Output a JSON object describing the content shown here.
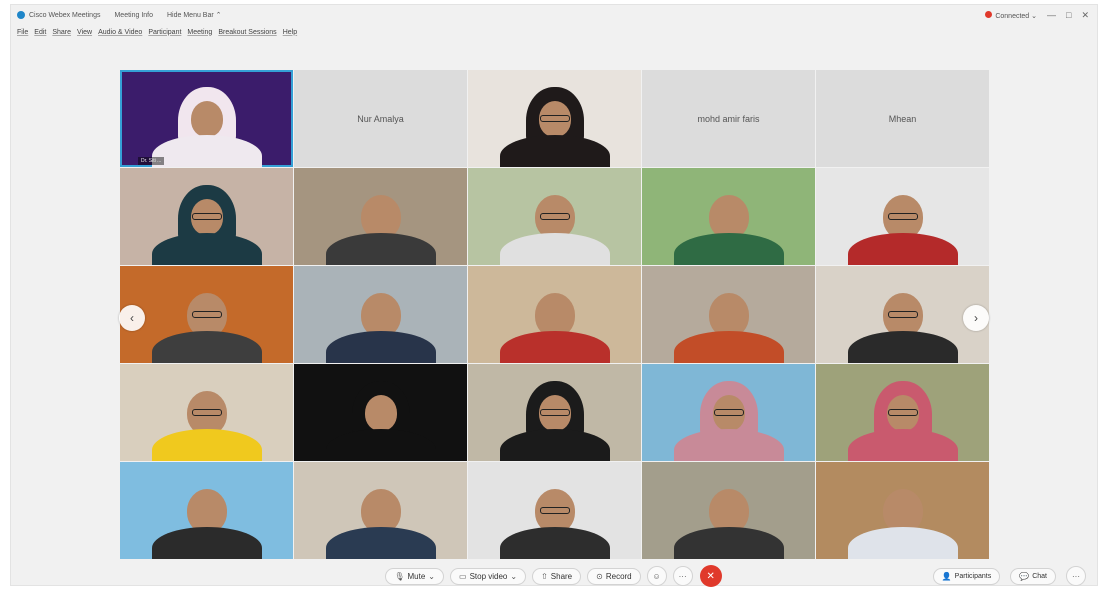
{
  "titlebar": {
    "app_name": "Cisco Webex Meetings",
    "meeting_info": "Meeting Info",
    "hide_menu": "Hide Menu Bar ⌃",
    "connected": "Connected ⌄",
    "min": "—",
    "max": "□",
    "close": "✕"
  },
  "menu": [
    "File",
    "Edit",
    "Share",
    "View",
    "Audio & Video",
    "Participant",
    "Meeting",
    "Breakout Sessions",
    "Help"
  ],
  "tiles": [
    {
      "label": "",
      "bg": "#3b1c6b",
      "person": "hijab",
      "hijab": "#f1e6ee",
      "shirt": "#efe9ef",
      "active": true,
      "name": "Dr. Siti ..."
    },
    {
      "label": "Nur Amalya",
      "noimg": true
    },
    {
      "label": "",
      "bg": "#e8e3dd",
      "person": "hijab",
      "hijab": "#1f1a1a",
      "shirt": "#1f1a1a",
      "glasses": true
    },
    {
      "label": "mohd amir faris",
      "noimg": true
    },
    {
      "label": "Mhean",
      "noimg": true
    },
    {
      "label": "",
      "bg": "#c6b3a6",
      "person": "hijab",
      "hijab": "#1c3a44",
      "shirt": "#1c3a44",
      "glasses": true
    },
    {
      "label": "",
      "bg": "#a59580",
      "person": "plain",
      "shirt": "#3a3a3a"
    },
    {
      "label": "",
      "bg": "#b7c4a2",
      "person": "plain",
      "shirt": "#e0e0e0",
      "glasses": true
    },
    {
      "label": "",
      "bg": "#8fb578",
      "person": "plain",
      "shirt": "#2f6b44"
    },
    {
      "label": "",
      "bg": "#e6e6e6",
      "person": "plain",
      "shirt": "#b42a2a",
      "glasses": true
    },
    {
      "label": "",
      "bg": "#c46a2a",
      "person": "plain",
      "shirt": "#3e3e3e",
      "glasses": true
    },
    {
      "label": "",
      "bg": "#aab3b8",
      "person": "plain",
      "shirt": "#28344a"
    },
    {
      "label": "",
      "bg": "#cdb89a",
      "person": "plain",
      "shirt": "#b9302b"
    },
    {
      "label": "",
      "bg": "#b5aa9c",
      "person": "plain",
      "shirt": "#c24d28"
    },
    {
      "label": "",
      "bg": "#d9d2c8",
      "person": "plain",
      "shirt": "#2a2a2a",
      "glasses": true
    },
    {
      "label": "",
      "bg": "#d9cfbe",
      "person": "plain",
      "shirt": "#f0c91e",
      "glasses": true
    },
    {
      "label": "",
      "bg": "#111111",
      "person": "hijab",
      "hijab": "#111",
      "shirt": "#111"
    },
    {
      "label": "",
      "bg": "#c0b8a6",
      "person": "hijab",
      "hijab": "#1b1b1b",
      "shirt": "#1b1b1b",
      "glasses": true
    },
    {
      "label": "",
      "bg": "#7fb7d6",
      "person": "hijab",
      "hijab": "#c88a98",
      "shirt": "#c88a98",
      "glasses": true
    },
    {
      "label": "",
      "bg": "#9ea27a",
      "person": "hijab",
      "hijab": "#c95a6e",
      "shirt": "#c95a6e",
      "glasses": true
    },
    {
      "label": "",
      "bg": "#7fbde0",
      "person": "plain",
      "shirt": "#2b2b2b"
    },
    {
      "label": "",
      "bg": "#cfc6b8",
      "person": "plain",
      "shirt": "#2a3b52"
    },
    {
      "label": "",
      "bg": "#e3e3e3",
      "person": "plain",
      "shirt": "#2d2d2d",
      "glasses": true
    },
    {
      "label": "",
      "bg": "#a39e8c",
      "person": "plain",
      "shirt": "#333"
    },
    {
      "label": "",
      "bg": "#b38b60",
      "person": "plain",
      "shirt": "#dfe3ea"
    }
  ],
  "controls": {
    "mute": "Mute",
    "stop_video": "Stop video",
    "share": "Share",
    "record": "Record",
    "participants": "Participants",
    "chat": "Chat"
  },
  "icons": {
    "mic": "🎙",
    "video": "▭",
    "share": "⇧",
    "record": "⊙",
    "reactions": "☺",
    "more": "···",
    "leave": "✕",
    "participants": "👤",
    "chat": "💬",
    "left_arrow": "‹",
    "right_arrow": "›"
  }
}
